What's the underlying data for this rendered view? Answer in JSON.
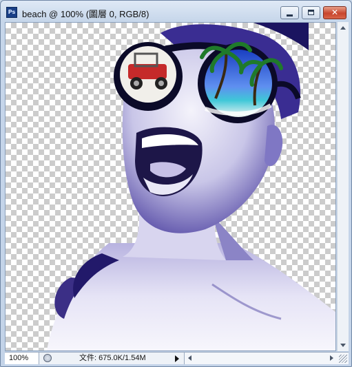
{
  "window": {
    "app_icon": "photoshop-icon",
    "app_icon_text": "Ps",
    "title": "beach @ 100% (圖層 0, RGB/8)",
    "controls": {
      "minimize": "minimize-icon",
      "maximize": "maximize-icon",
      "close": "close-icon",
      "close_glyph": "✕"
    }
  },
  "canvas": {
    "document": "beach",
    "layer": "圖層 0",
    "background": "transparency-checkerboard",
    "artwork": "laughing woman with large round sunglasses reflecting a jeep and a beach",
    "tint": "#3a2f8f"
  },
  "status": {
    "zoom": "100%",
    "doc_info": "文件: 675.0K/1.54M",
    "menu_arrow": "triangle-right-icon"
  }
}
